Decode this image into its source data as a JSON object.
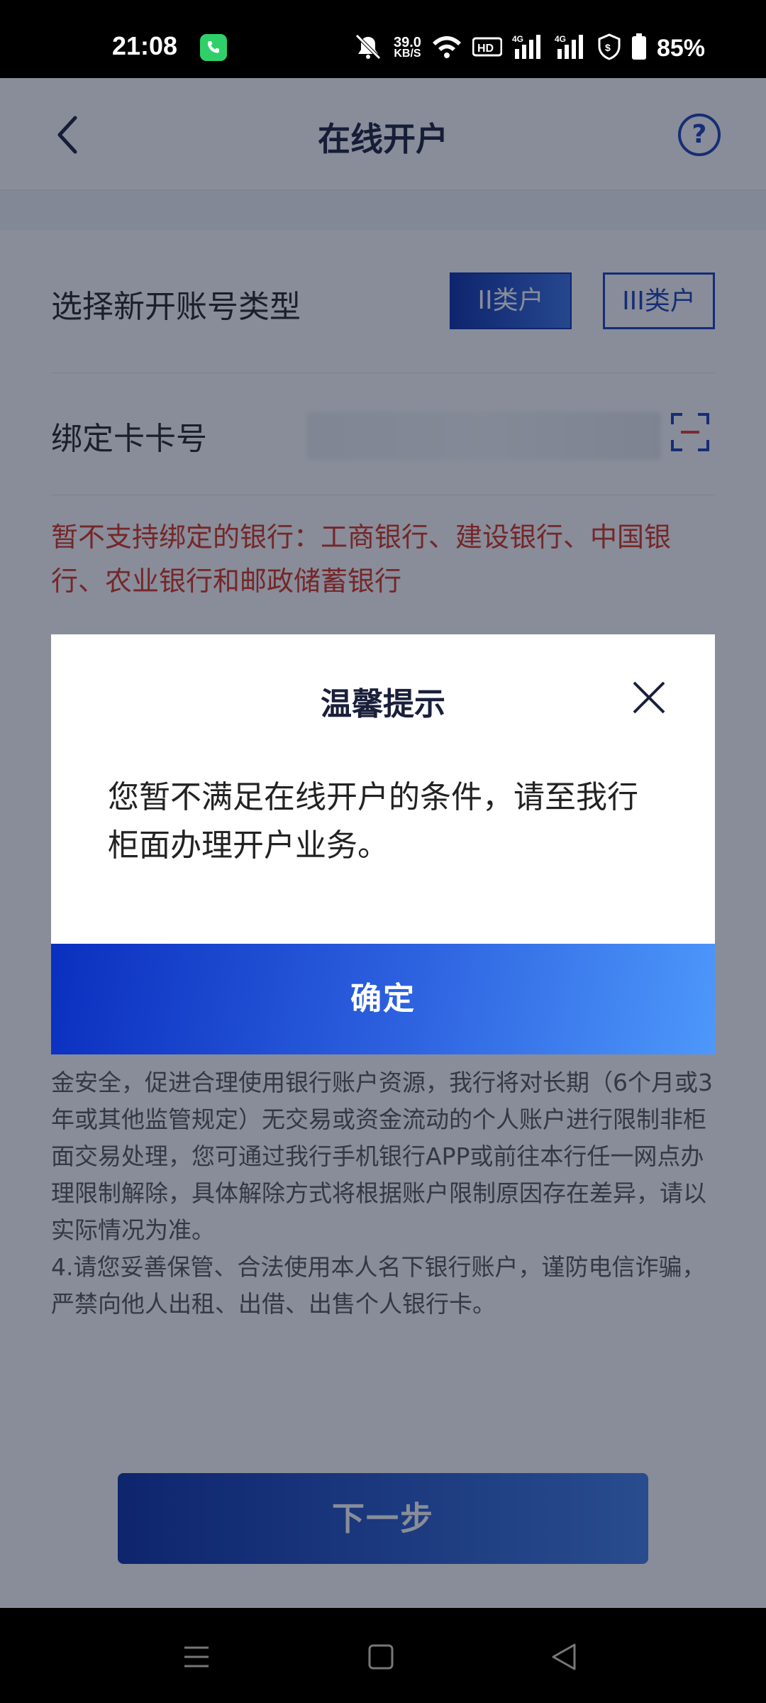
{
  "status_bar": {
    "time": "21:08",
    "net_speed_value": "39.0",
    "net_speed_unit": "KB/S",
    "battery_percent": "85%",
    "icons": [
      "call-icon",
      "mute-icon",
      "wifi-icon",
      "hd-icon",
      "signal-4g-icon",
      "signal-4g-icon",
      "security-icon",
      "battery-icon"
    ]
  },
  "header": {
    "title": "在线开户",
    "back_icon": "chevron-left-icon",
    "help_icon": "help-circle-icon",
    "help_glyph": "?"
  },
  "form": {
    "account_type_label": "选择新开账号类型",
    "account_type_options": [
      "II类户",
      "III类户"
    ],
    "account_type_selected": "II类户",
    "card_number_label": "绑定卡卡号",
    "scan_icon": "scan-card-icon"
  },
  "warning": "暂不支持绑定的银行：工商银行、建设银行、中国银行、农业银行和邮政储蓄银行",
  "notice": {
    "lines": [
      "金安全，促进合理使用银行账户资源，我行将对长期（6个月或3年或其他监管规定）无交易或资金流动的个人账户进行限制非柜面交易处理，您可通过我行手机银行APP或前往本行任一网点办理限制解除，具体解除方式将根据账户限制原因存在差异，请以实际情况为准。",
      "4.请您妥善保管、合法使用本人名下银行账户，谨防电信诈骗，严禁向他人出租、出借、出售个人银行卡。"
    ]
  },
  "next_button": "下一步",
  "dialog": {
    "title": "温馨提示",
    "message": "您暂不满足在线开户的条件，请至我行柜面办理开户业务。",
    "confirm": "确定",
    "close_icon": "close-icon"
  },
  "nav_bar": {
    "items": [
      "menu-icon",
      "home-square-icon",
      "back-triangle-icon"
    ]
  },
  "colors": {
    "primary": "#1b3fb8",
    "warning": "#d8301f",
    "overlay": "rgba(18,28,52,0.5)"
  }
}
